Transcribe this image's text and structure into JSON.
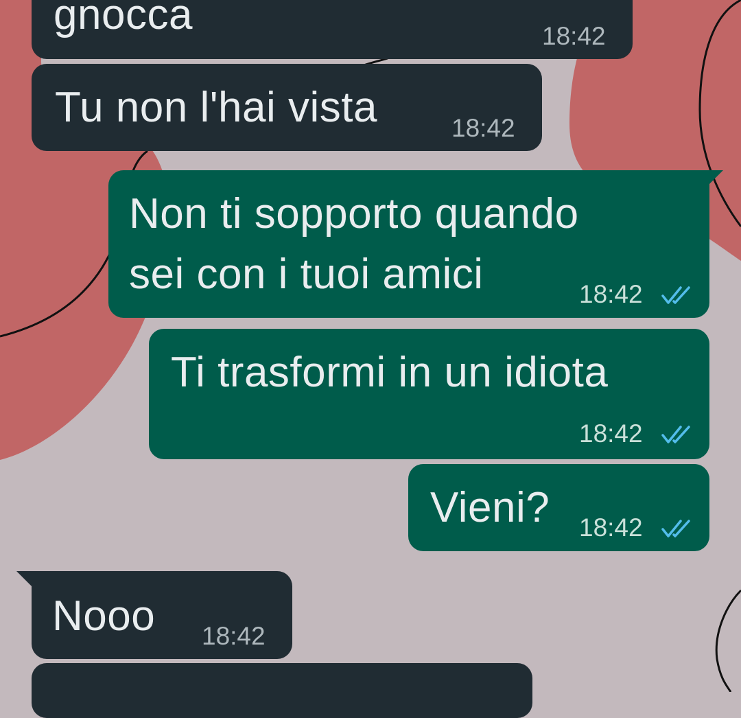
{
  "chat": {
    "messages": [
      {
        "direction": "in",
        "text": "gnocca",
        "time": "18:42"
      },
      {
        "direction": "in",
        "text": "Tu non l'hai vista",
        "time": "18:42"
      },
      {
        "direction": "out",
        "lines": [
          "Non ti sopporto quando",
          "sei con i tuoi amici"
        ],
        "time": "18:42",
        "status": "read"
      },
      {
        "direction": "out",
        "text": "Ti trasformi in un idiota",
        "time": "18:42",
        "status": "read"
      },
      {
        "direction": "out",
        "text": "Vieni?",
        "time": "18:42",
        "status": "read"
      },
      {
        "direction": "in",
        "text": "Nooo",
        "time": "18:42"
      }
    ]
  },
  "colors": {
    "incoming_bubble": "#202c33",
    "outgoing_bubble": "#005c4b",
    "read_ticks": "#53bdeb",
    "wallpaper_blob": "#c16666",
    "wallpaper_bg": "#c3b9bd"
  },
  "icons": {
    "read_receipt": "double-check-icon"
  }
}
